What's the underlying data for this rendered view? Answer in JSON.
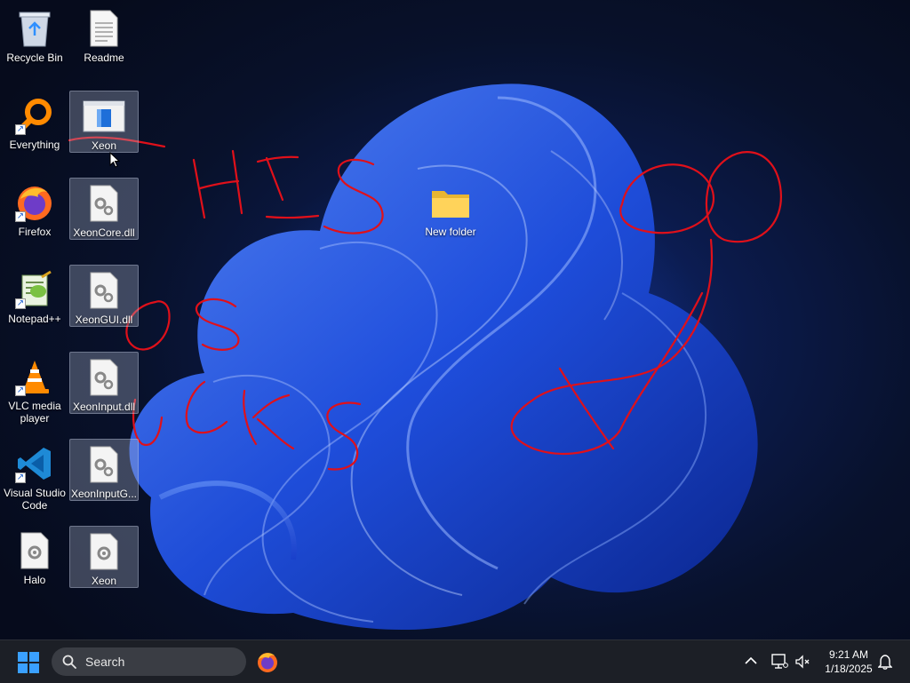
{
  "desktop": {
    "icons": [
      {
        "id": "recycle-bin",
        "label": "Recycle Bin"
      },
      {
        "id": "readme",
        "label": "Readme"
      },
      {
        "id": "everything",
        "label": "Everything"
      },
      {
        "id": "xeon-exe",
        "label": "Xeon"
      },
      {
        "id": "firefox",
        "label": "Firefox"
      },
      {
        "id": "xeoncore",
        "label": "XeonCore.dll"
      },
      {
        "id": "new-folder",
        "label": "New folder"
      },
      {
        "id": "notepadpp",
        "label": "Notepad++"
      },
      {
        "id": "xeongui",
        "label": "XeonGUI.dll"
      },
      {
        "id": "vlc",
        "label": "VLC media player"
      },
      {
        "id": "xeoninput",
        "label": "XeonInput.dll"
      },
      {
        "id": "vscode",
        "label": "Visual Studio Code"
      },
      {
        "id": "xeoninputg",
        "label": "XeonInputG..."
      },
      {
        "id": "halo",
        "label": "Halo"
      },
      {
        "id": "xeon-file",
        "label": "Xeon"
      }
    ],
    "scribble_color": "#e0101a"
  },
  "taskbar": {
    "search_label": "Search",
    "time": "9:21 AM",
    "date": "1/18/2025",
    "accent": "#1e90ff"
  }
}
